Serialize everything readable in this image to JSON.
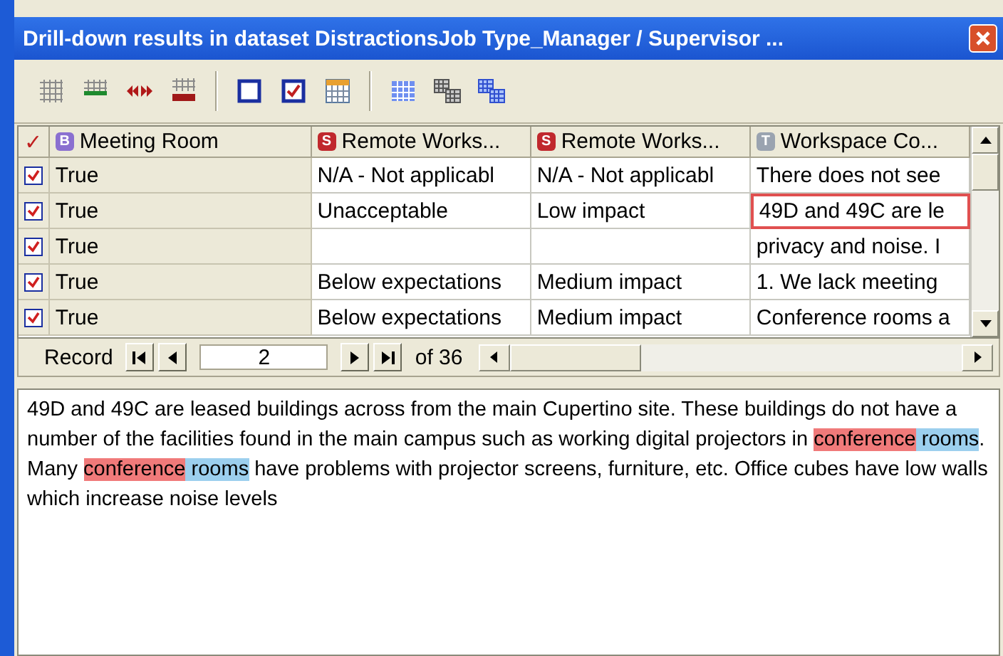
{
  "window": {
    "title": "Drill-down results in dataset DistractionsJob Type_Manager / Supervisor ..."
  },
  "toolbar": [
    {
      "kind": "grid"
    },
    {
      "kind": "rowline"
    },
    {
      "kind": "arrows"
    },
    {
      "kind": "gridstamp"
    },
    {
      "kind": "sep"
    },
    {
      "kind": "box"
    },
    {
      "kind": "checkbox"
    },
    {
      "kind": "calendar"
    },
    {
      "kind": "sep"
    },
    {
      "kind": "bluegrid"
    },
    {
      "kind": "stack"
    },
    {
      "kind": "bluestack"
    }
  ],
  "table": {
    "check_header": "✓",
    "columns": [
      {
        "badge": "B",
        "color": "#8a6fd0",
        "label": "Meeting Room"
      },
      {
        "badge": "S",
        "color": "#c0282d",
        "label": "Remote Works..."
      },
      {
        "badge": "S",
        "color": "#c0282d",
        "label": "Remote Works..."
      },
      {
        "badge": "T",
        "color": "#9aa3b0",
        "label": "Workspace Co..."
      }
    ],
    "rows": [
      {
        "checked": true,
        "focused_cell": false,
        "cells": [
          "True",
          "N/A - Not applicabl",
          "N/A - Not applicabl",
          "There does not see"
        ]
      },
      {
        "checked": true,
        "focused_cell": true,
        "cells": [
          "True",
          "Unacceptable",
          "Low impact",
          "49D and 49C are le"
        ]
      },
      {
        "checked": true,
        "focused_cell": false,
        "cells": [
          "True",
          "",
          "",
          "privacy and noise.  I"
        ]
      },
      {
        "checked": true,
        "focused_cell": false,
        "cells": [
          "True",
          "Below expectations",
          "Medium impact",
          "1.  We lack meeting"
        ]
      },
      {
        "checked": true,
        "focused_cell": false,
        "cells": [
          "True",
          "Below expectations",
          "Medium impact",
          "Conference rooms a"
        ]
      }
    ]
  },
  "navigator": {
    "label": "Record",
    "value": "2",
    "total": "of 36"
  },
  "detail": {
    "segments": [
      {
        "text": "49D and 49C are leased buildings across from the main Cupertino site.  These buildings do not have a number of the facilities found in the main campus such as working digital projectors in "
      },
      {
        "text": "conference",
        "color": "#f07a7a"
      },
      {
        "text": " rooms",
        "color": "#9ccfee"
      },
      {
        "text": ".  Many "
      },
      {
        "text": "conference",
        "color": "#f07a7a"
      },
      {
        "text": " rooms",
        "color": "#9ccfee"
      },
      {
        "text": " have problems with projector screens, furniture, etc.  Office cubes have low walls which increase noise levels"
      }
    ]
  }
}
